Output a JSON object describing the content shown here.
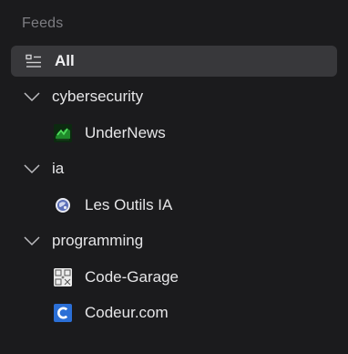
{
  "sidebar": {
    "section_title": "Feeds",
    "all": {
      "label": "All",
      "icon": "list-icon"
    },
    "groups": [
      {
        "label": "cybersecurity",
        "expanded": true,
        "feeds": [
          {
            "label": "UnderNews",
            "icon": "undernews-favicon"
          }
        ]
      },
      {
        "label": "ia",
        "expanded": true,
        "feeds": [
          {
            "label": "Les Outils IA",
            "icon": "les-outils-ia-favicon"
          }
        ]
      },
      {
        "label": "programming",
        "expanded": true,
        "feeds": [
          {
            "label": "Code-Garage",
            "icon": "code-garage-favicon"
          },
          {
            "label": "Codeur.com",
            "icon": "codeur-favicon"
          }
        ]
      }
    ]
  },
  "colors": {
    "background": "#1b1b1d",
    "selected_row": "#38383b",
    "muted_text": "#7d7d82",
    "text": "#e6e6e8"
  }
}
